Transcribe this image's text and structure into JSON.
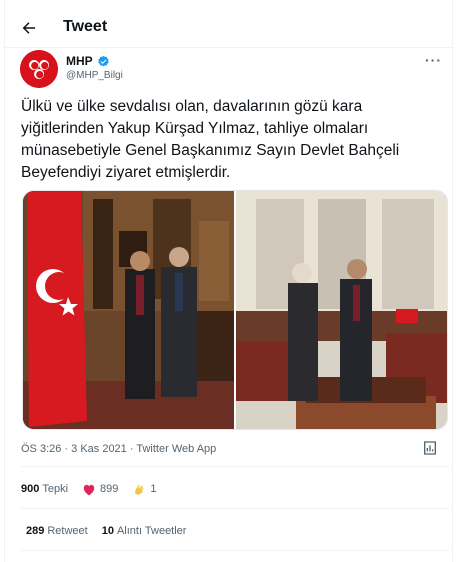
{
  "header": {
    "title": "Tweet"
  },
  "author": {
    "name": "MHP",
    "handle": "@MHP_Bilgi"
  },
  "tweet": {
    "lines": [
      "Ülkü ve ülke sevdalısı olan, davalarının gözü kara",
      "yiğitlerinden Yakup Kürşad Yılmaz, tahliye olmaları",
      "münasebetiyle Genel Başkanımız Sayın Devlet Bahçeli",
      "Beyefendiyi ziyaret etmişlerdir."
    ]
  },
  "meta": {
    "time": "ÖS 3:26",
    "date": "3 Kas 2021",
    "separator": " · ",
    "source": "Twitter Web App"
  },
  "stats": {
    "reactions_count": "900",
    "reactions_label": "Tepki",
    "hearts": "899",
    "claps": "1",
    "retweets_count": "289",
    "retweets_label": "Retweet",
    "quotes_count": "10",
    "quotes_label": "Alıntı Tweetler"
  },
  "colors": {
    "brand_red": "#d8121b",
    "verified_blue": "#1d9bf0",
    "muted": "#536471"
  }
}
